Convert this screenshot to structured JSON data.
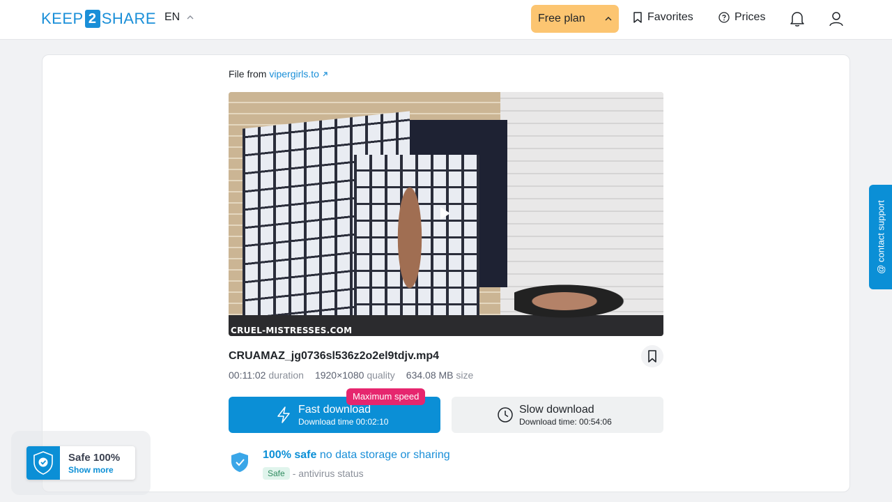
{
  "header": {
    "logo_left": "KEEP",
    "logo_mid": "2",
    "logo_right": "SHARE",
    "language": "EN",
    "plan_label": "Free plan",
    "favorites_label": "Favorites",
    "prices_label": "Prices"
  },
  "file": {
    "source_prefix": "File from",
    "source_link": "vipergirls.to",
    "watermark": "CRUEL-MISTRESSES.COM",
    "name": "CRUAMAZ_jg0736sl536z2o2el9tdjv.mp4",
    "duration_value": "00:11:02",
    "duration_label": "duration",
    "quality_value": "1920×1080",
    "quality_label": "quality",
    "size_value": "634.08 MB",
    "size_label": "size"
  },
  "download": {
    "badge": "Maximum speed",
    "fast_title": "Fast download",
    "fast_time": "Download time 00:02:10",
    "slow_title": "Slow download",
    "slow_time": "Download time: 00:54:06"
  },
  "safety": {
    "strong": "100% safe",
    "rest": "no data storage or sharing",
    "badge": "Safe",
    "status": "- antivirus status"
  },
  "support_label": "@ contact support",
  "safe_widget": {
    "title": "Safe 100%",
    "link": "Show more"
  },
  "colors": {
    "brand": "#0b8fd6",
    "plan": "#fcc571",
    "badge": "#e6266e"
  }
}
